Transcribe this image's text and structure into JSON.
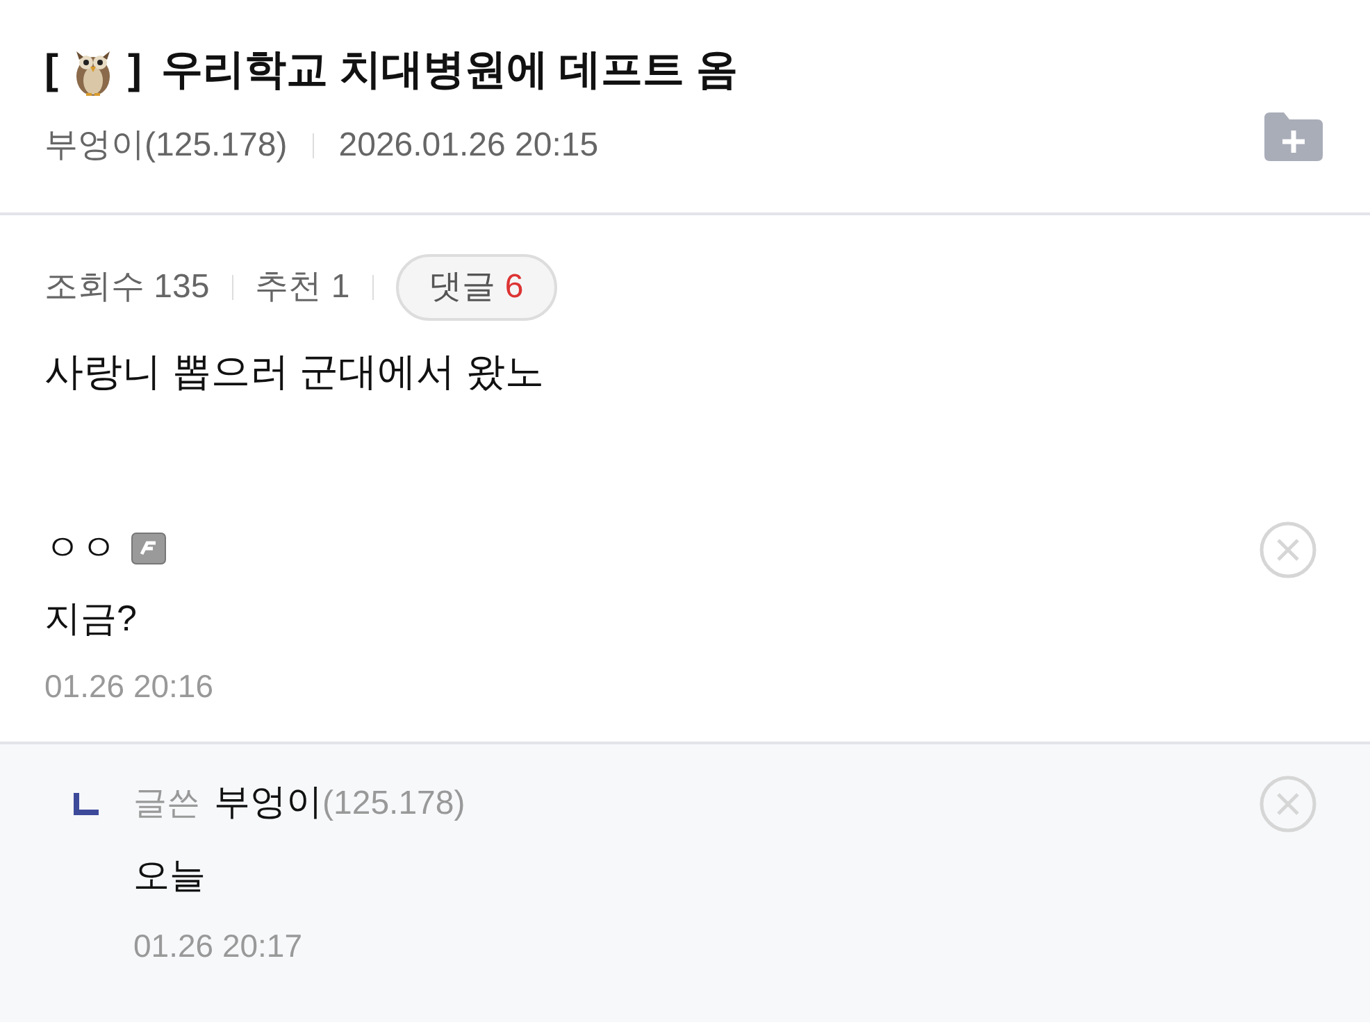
{
  "post": {
    "title_open": "[",
    "title_close": "]",
    "title": "우리학교 치대병원에 데프트 옴",
    "author": "부엉이(125.178)",
    "date": "2026.01.26 20:15",
    "views": "조회수 135",
    "recommend": "추천 1",
    "comments_label": "댓글",
    "comments_count": "6",
    "body": "사랑니 뽑으러 군대에서 왔노"
  },
  "comments": [
    {
      "kind": "comment",
      "name": "ㅇㅇ",
      "fixed_nick": true,
      "text": "지금?",
      "time": "01.26 20:16"
    },
    {
      "kind": "reply",
      "author_badge": "글쓴",
      "name": "부엉이",
      "ip": "(125.178)",
      "text": "오늘",
      "time": "01.26 20:17"
    }
  ]
}
